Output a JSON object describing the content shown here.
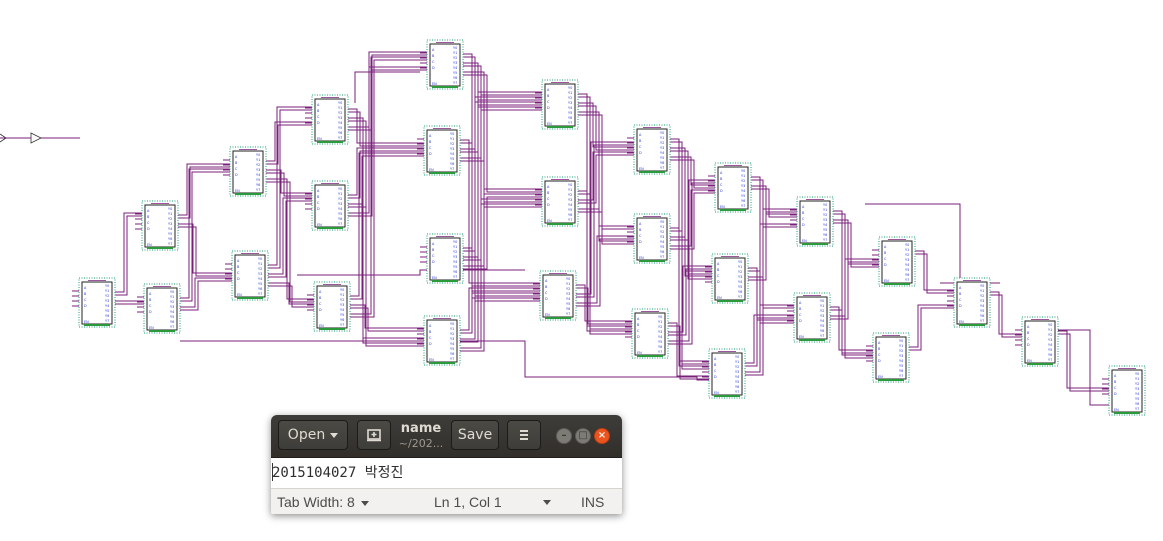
{
  "schematic": {
    "block_pins": [
      "A",
      "B",
      "C",
      "D",
      "EN",
      "Y0",
      "Y1",
      "Y2",
      "Y3",
      "Y4",
      "Y5",
      "Y6",
      "Y7"
    ],
    "colors": {
      "wire": "#7a1f7a",
      "pin_text": "#2b3bd6",
      "outline": "#1b9e7a"
    }
  },
  "editor_window": {
    "open_label": "Open",
    "new_tab_icon": "new-document-icon",
    "doc_title": "name",
    "doc_path": "~/202...",
    "save_label": "Save",
    "menu_icon": "hamburger-menu-icon",
    "content": "2015104027 박정진",
    "status": {
      "tab_width": "Tab Width: 8",
      "cursor_position": "Ln 1, Col 1",
      "mode": "INS"
    },
    "colors": {
      "header": "#3a3935",
      "close": "#e9541f"
    }
  }
}
